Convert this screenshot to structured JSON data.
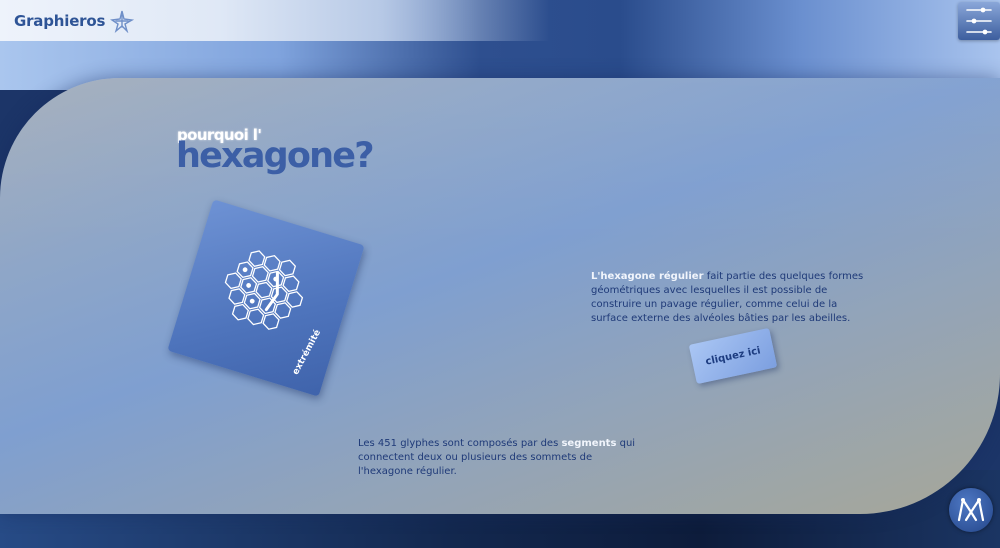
{
  "header": {
    "logo_text": "Graphieros",
    "logo_icon": "star-sparkle-icon",
    "menu_icon": "sliders-icon"
  },
  "main": {
    "title_small": "pourquoi l'",
    "title_big": "hexagone?",
    "card_caption": "extrémité",
    "description": {
      "highlight": "L'hexagone régulier",
      "rest": " fait partie des quelques formes géométriques avec lesquelles il est possible de construire un pavage régulier, comme celui de la surface externe des alvéoles bâties par les abeilles."
    },
    "cta_label": "cliquez ici",
    "glyph_text": {
      "before": "Les 451 glyphes sont composés par des ",
      "highlight": "segments",
      "after": " qui connectent deux ou plusieurs des sommets de l'hexagone régulier."
    }
  },
  "footer": {
    "corner_logo_icon": "graphieros-emblem-icon"
  },
  "colors": {
    "accent": "#3c5fa6",
    "text": "#1f3a78",
    "highlight": "#f1f5fc"
  }
}
